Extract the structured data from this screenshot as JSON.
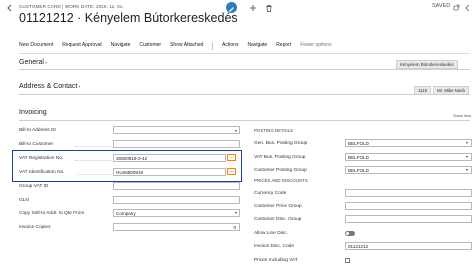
{
  "header": {
    "subtitle": "CUSTOMER CARD | WORK DATE: 2019. 11. 01.",
    "title": "01121212 · Kényelem Bútorkereskedés",
    "saved_label": "SAVED"
  },
  "actions": [
    {
      "label": "New Document",
      "muted": false
    },
    {
      "label": "Request Approval",
      "muted": false
    },
    {
      "label": "Navigate",
      "muted": false
    },
    {
      "label": "Customer",
      "muted": false
    },
    {
      "label": "Show Attached",
      "muted": false
    },
    {
      "label": "Actions",
      "muted": false
    },
    {
      "label": "Navigate",
      "muted": false
    },
    {
      "label": "Report",
      "muted": false
    },
    {
      "label": "Fewer options",
      "muted": true
    }
  ],
  "general": {
    "title": "General",
    "chip": "Kényelem Bútorkereskedés"
  },
  "address": {
    "title": "Address & Contact",
    "chip_a": "1115",
    "chip_b": "Mr. Mike Nash"
  },
  "invoicing": {
    "title": "Invoicing",
    "show_less": "Show less",
    "left_fields": [
      {
        "label": "Bill-to Address ID",
        "value": ""
      },
      {
        "label": "Bill-to Customer",
        "value": ""
      },
      {
        "label": "VAT Registration No.",
        "value": "26500919-2-42"
      },
      {
        "label": "VAT Identification No.",
        "value": "HU26500919"
      },
      {
        "label": "Group VAT ID",
        "value": ""
      },
      {
        "label": "GLN",
        "value": ""
      },
      {
        "label": "Copy Sell-to Addr. to Qte From",
        "value": "Company"
      },
      {
        "label": "Invoice Copies",
        "value": "0"
      }
    ],
    "posting_header": "POSTING DETAILS",
    "posting_fields": [
      {
        "label": "Gen. Bus. Posting Group",
        "value": "BELFOLD"
      },
      {
        "label": "VAT Bus. Posting Group",
        "value": "BELFOLD"
      },
      {
        "label": "Customer Posting Group",
        "value": "BELFOLD"
      }
    ],
    "prices_header": "PRICES AND DISCOUNTS",
    "prices_fields": [
      {
        "label": "Currency Code",
        "value": ""
      },
      {
        "label": "Customer Price Group",
        "value": ""
      },
      {
        "label": "Customer Disc. Group",
        "value": ""
      },
      {
        "label": "Allow Line Disc.",
        "value": ""
      },
      {
        "label": "Invoice Disc. Code",
        "value": "01121212"
      },
      {
        "label": "Prices Including VAT",
        "value": ""
      }
    ]
  }
}
